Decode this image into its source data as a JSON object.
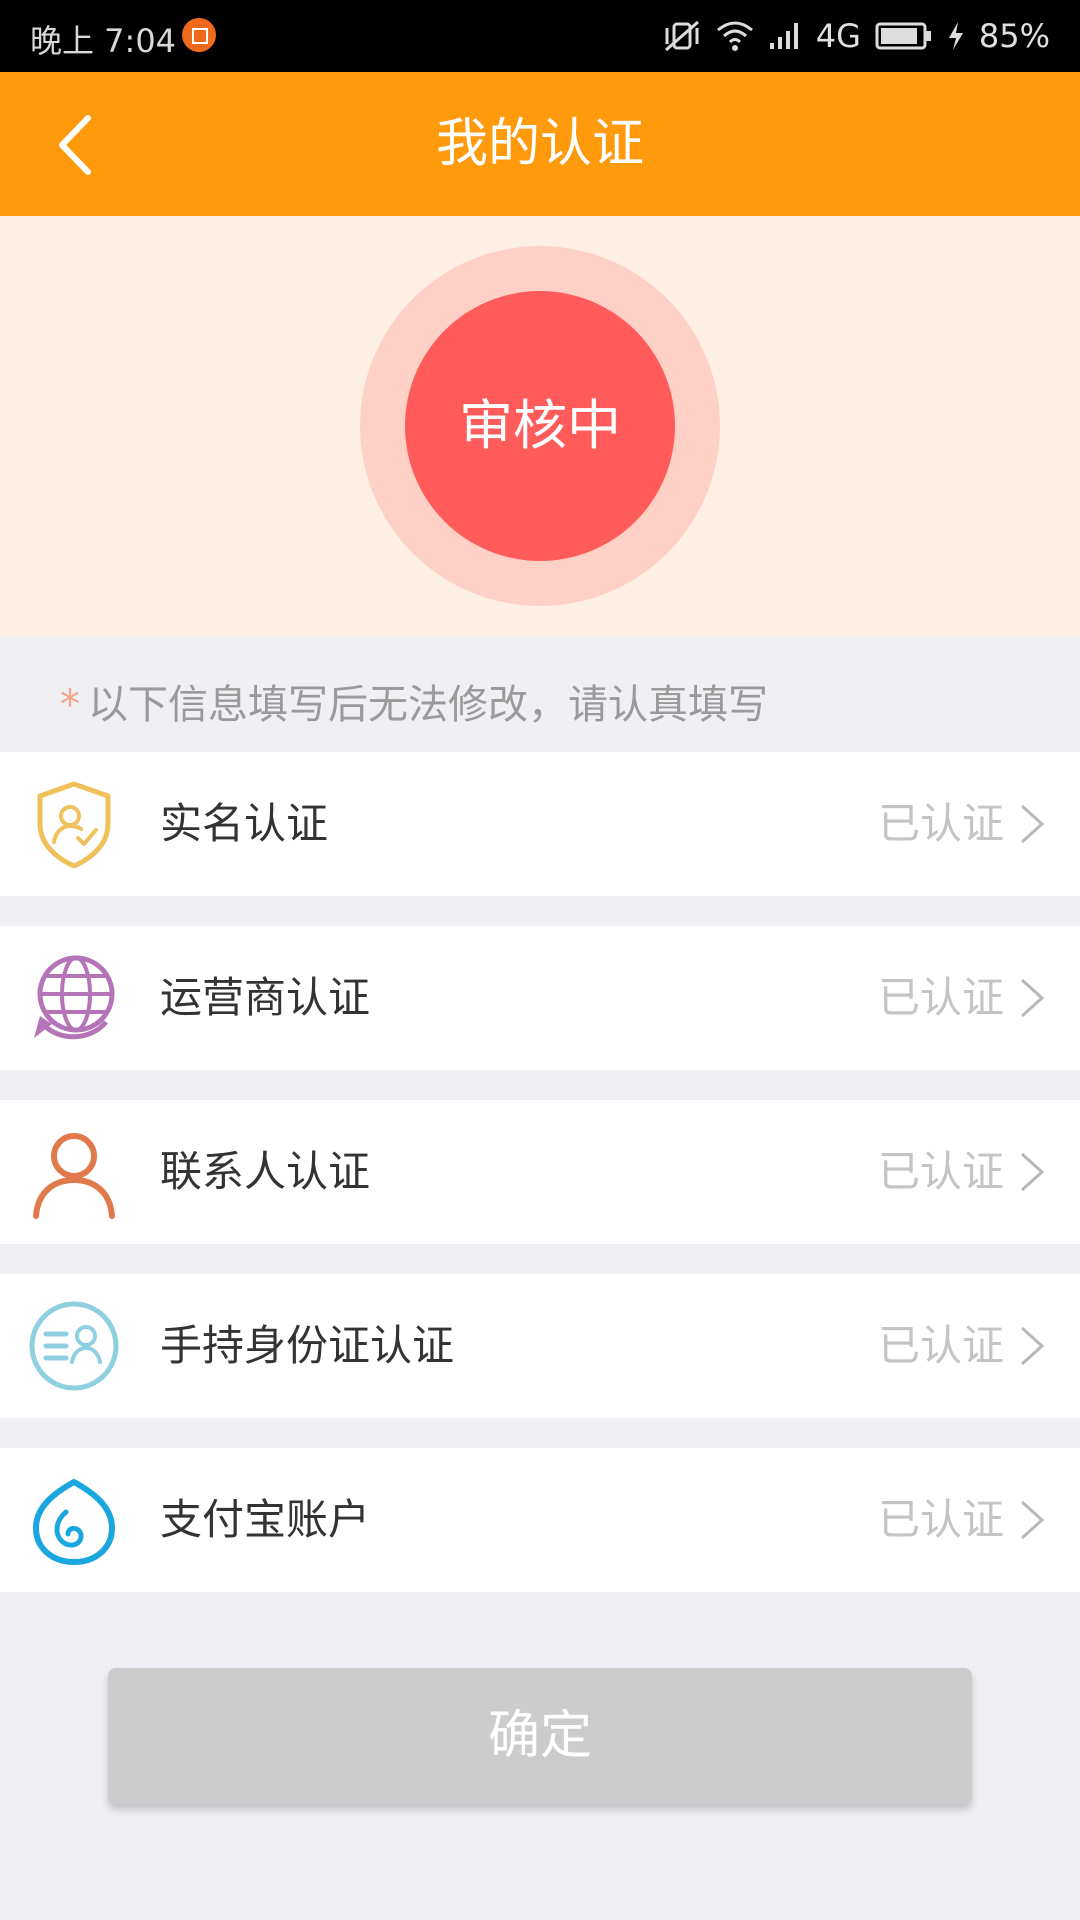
{
  "status_bar": {
    "time": "晚上 7:04",
    "network": "4G",
    "battery": "85%",
    "icons": [
      "notification-badge-icon",
      "vibrate-off-icon",
      "wifi-icon",
      "signal-icon",
      "battery-icon",
      "charging-icon"
    ]
  },
  "header": {
    "title": "我的认证",
    "back_icon": "back-arrow-icon",
    "background_color": "#ff9a0c"
  },
  "hero": {
    "status_label": "审核中",
    "colors": {
      "outer": "#ffd1c6",
      "inner": "#ff5b5b",
      "background": "#fdf0e2"
    }
  },
  "notice": {
    "asterisk": "*",
    "text": "以下信息填写后无法修改，请认真填写"
  },
  "auth_items": [
    {
      "label": "实名认证",
      "status": "已认证",
      "icon": "shield-person-icon"
    },
    {
      "label": "运营商认证",
      "status": "已认证",
      "icon": "globe-icon"
    },
    {
      "label": "联系人认证",
      "status": "已认证",
      "icon": "person-icon"
    },
    {
      "label": "手持身份证认证",
      "status": "已认证",
      "icon": "id-card-icon"
    },
    {
      "label": "支付宝账户",
      "status": "已认证",
      "icon": "alipay-icon"
    }
  ],
  "confirm_button": {
    "label": "确定",
    "background_color": "#cccccc"
  }
}
